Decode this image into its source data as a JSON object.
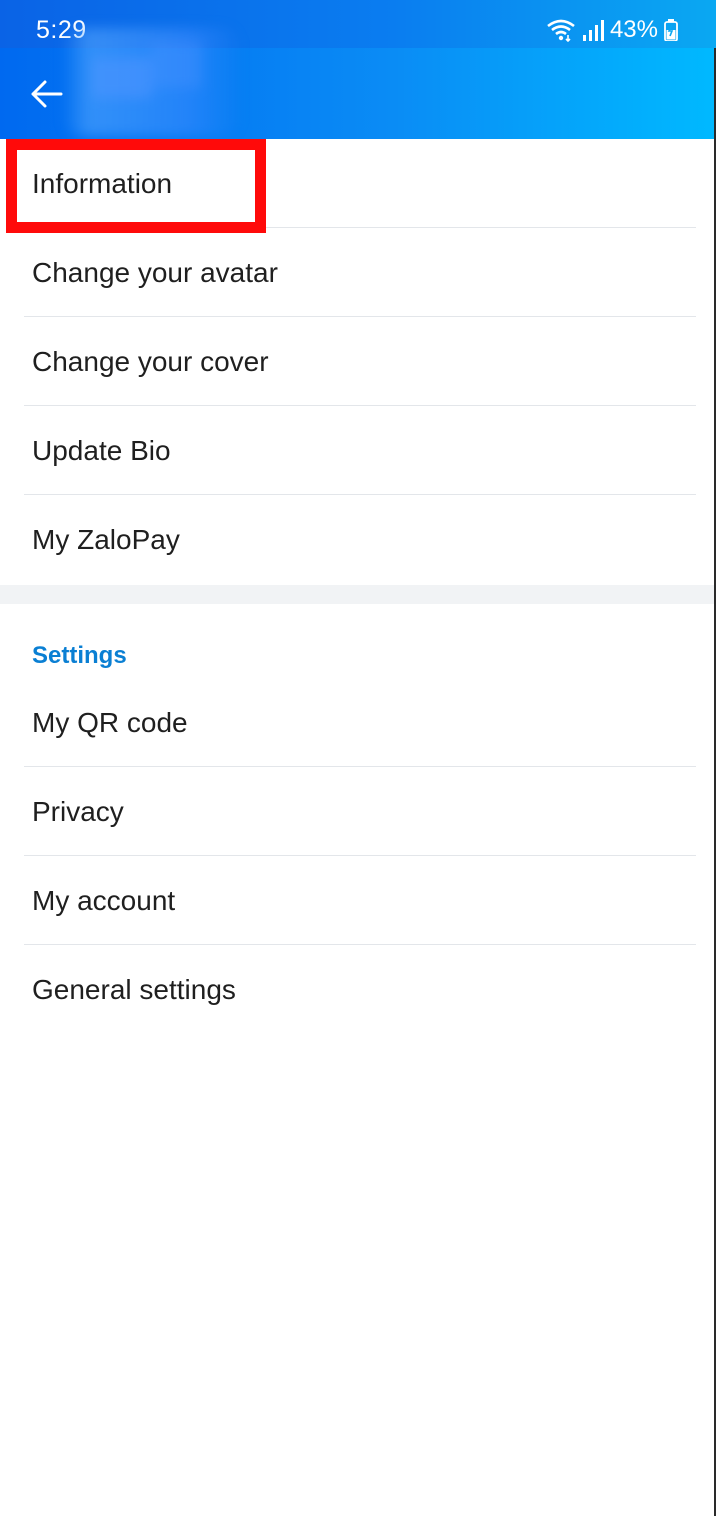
{
  "status_bar": {
    "time": "5:29",
    "battery": "43%",
    "icons": [
      "wifi-icon",
      "signal-icon",
      "battery-icon"
    ]
  },
  "app_bar": {
    "back_icon": "arrow-left-icon",
    "title": ""
  },
  "profile_menu": {
    "items": [
      {
        "label": "Information"
      },
      {
        "label": "Change your avatar"
      },
      {
        "label": "Change your cover"
      },
      {
        "label": "Update Bio"
      },
      {
        "label": "My ZaloPay"
      }
    ]
  },
  "settings": {
    "header": "Settings",
    "items": [
      {
        "label": "My QR code"
      },
      {
        "label": "Privacy"
      },
      {
        "label": "My account"
      },
      {
        "label": "General settings"
      }
    ]
  },
  "colors": {
    "header_gradient_start": "#0069f0",
    "header_gradient_end": "#00b9ff",
    "highlight_border": "#ff0a0a",
    "section_header": "#0a7fd3"
  }
}
